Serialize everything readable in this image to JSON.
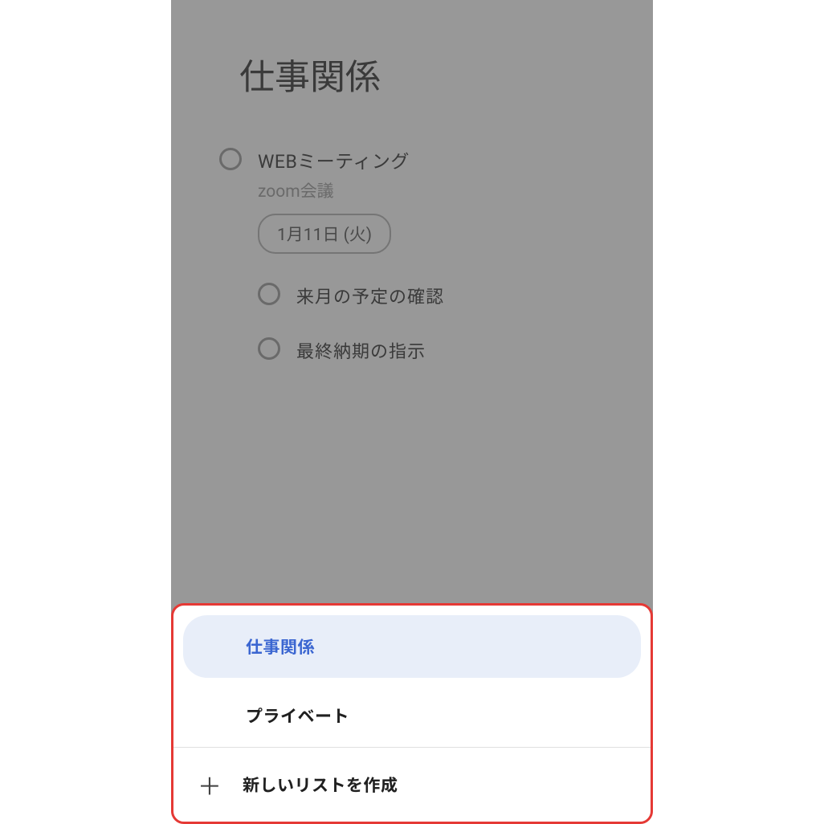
{
  "header": {
    "title": "仕事関係"
  },
  "tasks": [
    {
      "title": "WEBミーティング",
      "subtitle": "zoom会議",
      "date": "1月11日 (火)"
    }
  ],
  "subtasks": [
    {
      "title": "来月の予定の確認"
    },
    {
      "title": "最終納期の指示"
    }
  ],
  "bottomSheet": {
    "items": [
      {
        "label": "仕事関係",
        "selected": true
      },
      {
        "label": "プライベート",
        "selected": false
      }
    ],
    "createNew": "新しいリストを作成"
  }
}
